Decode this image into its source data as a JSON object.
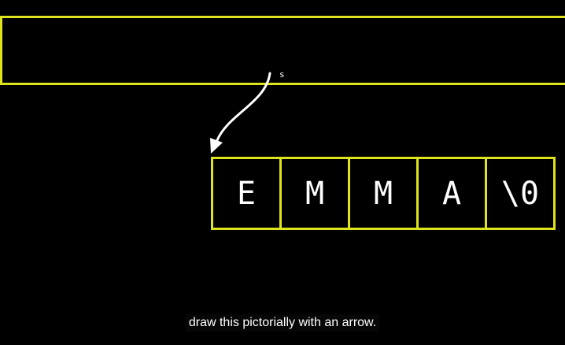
{
  "diagram": {
    "pointer_label": "s",
    "cells": [
      "E",
      "M",
      "M",
      "A",
      "\\0"
    ],
    "colors": {
      "background": "#000000",
      "outline": "#dfe31b",
      "text": "#ffffff"
    }
  },
  "caption": {
    "text": "draw this pictorially with an arrow."
  }
}
